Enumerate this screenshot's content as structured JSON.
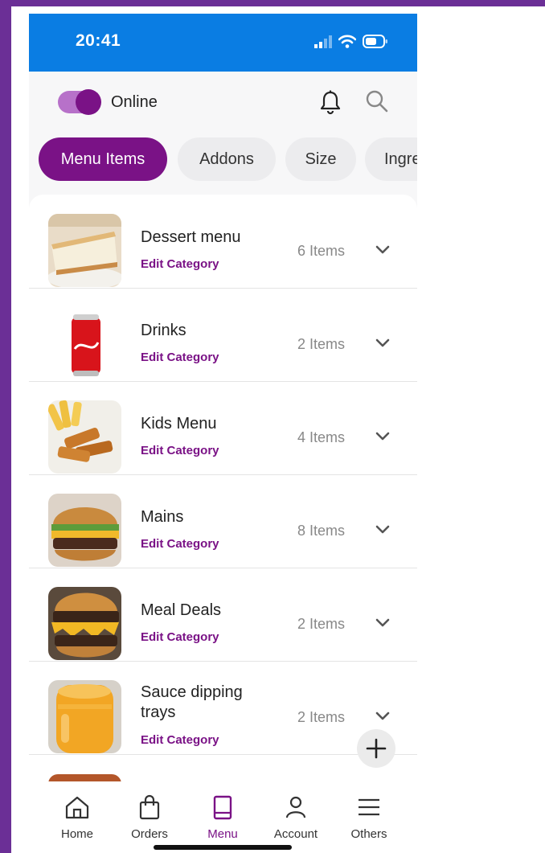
{
  "status_bar": {
    "time": "20:41"
  },
  "header": {
    "online_label": "Online",
    "online_on": true
  },
  "tabs": [
    "Menu Items",
    "Addons",
    "Size",
    "Ingre"
  ],
  "categories": [
    {
      "name": "Dessert menu",
      "edit": "Edit Category",
      "count": "6 Items"
    },
    {
      "name": "Drinks",
      "edit": "Edit Category",
      "count": "2 Items"
    },
    {
      "name": "Kids Menu",
      "edit": "Edit Category",
      "count": "4 Items"
    },
    {
      "name": "Mains",
      "edit": "Edit Category",
      "count": "8 Items"
    },
    {
      "name": "Meal Deals",
      "edit": "Edit Category",
      "count": "2 Items"
    },
    {
      "name": "Sauce dipping trays",
      "edit": "Edit Category",
      "count": "2 Items"
    }
  ],
  "nav": [
    "Home",
    "Orders",
    "Menu",
    "Account",
    "Others"
  ],
  "colors": {
    "brand": "#7a1286",
    "status_bar": "#0a7de3",
    "toggle_track": "#b771c9",
    "background": "#6b2f96"
  },
  "icons": {
    "header": [
      "bell-icon",
      "search-icon"
    ],
    "row": "chevron-down-icon",
    "fab": "plus-icon",
    "nav": [
      "home-icon",
      "bag-icon",
      "book-icon",
      "user-icon",
      "menu-icon"
    ]
  }
}
